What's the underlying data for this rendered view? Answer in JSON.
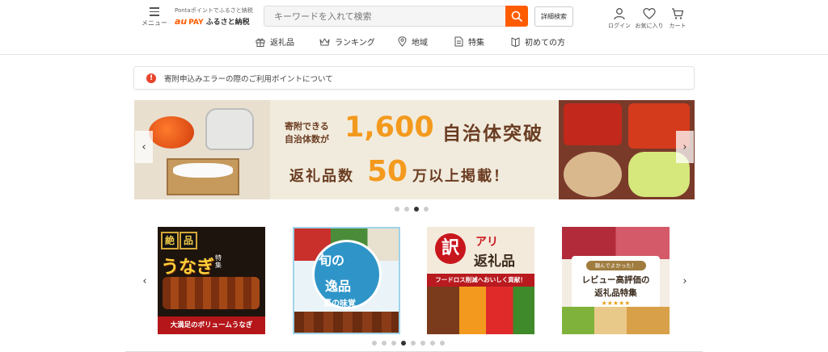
{
  "header": {
    "menu_label": "メニュー",
    "logo_sub": "Pontaポイントでふるさと納税",
    "logo_au": "au",
    "logo_pay": "PAY",
    "logo_main": "ふるさと納税",
    "search_placeholder": "キーワードを入れて検索",
    "advanced_search_label": "詳細検索",
    "login_label": "ログイン",
    "favorites_label": "お気に入り",
    "cart_label": "カート",
    "accent_color": "#ff5c00"
  },
  "nav": {
    "items": [
      {
        "label": "返礼品",
        "icon": "gift-icon"
      },
      {
        "label": "ランキング",
        "icon": "crown-icon"
      },
      {
        "label": "地域",
        "icon": "map-pin-icon"
      },
      {
        "label": "特集",
        "icon": "document-icon"
      },
      {
        "label": "初めての方",
        "icon": "book-icon"
      }
    ]
  },
  "notice": {
    "icon": "!",
    "text": "寄附申込みエラーの際のご利用ポイントについて"
  },
  "hero": {
    "line1a": "寄附できる",
    "line1b": "自治体数が",
    "big_number": "1,600",
    "line1c": "自治体突破",
    "line2a": "返礼品数",
    "big_number2": "50",
    "line2b": "万以上掲載！",
    "slide_count": 4,
    "active_slide": 3
  },
  "cards": {
    "card1": {
      "tag1": "絶",
      "tag2": "品",
      "title": "うなぎ",
      "side": "特集",
      "bottom": "大満足のボリュームうなぎ"
    },
    "card2": {
      "t1": "旬の",
      "t2": "逸品",
      "t3": "夏の味覚"
    },
    "card3": {
      "kanji": "訳",
      "ari": "アリ",
      "title": "返礼品",
      "strip": "フードロス削減へおいしく貢献！"
    },
    "card4": {
      "tag": "頼んでよかった！",
      "t1": "レビュー高評価の",
      "t2": "返礼品特集",
      "stars": "★★★★★"
    },
    "dot_count": 8,
    "active_dot": 4
  },
  "arrows": {
    "left": "‹",
    "right": "›"
  }
}
